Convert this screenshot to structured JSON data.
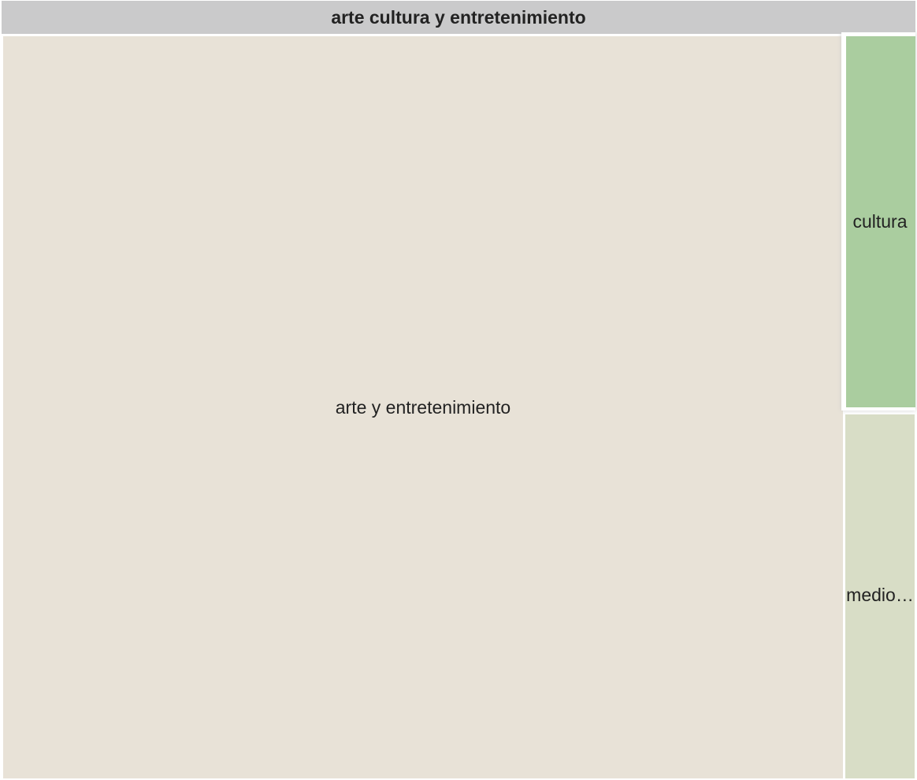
{
  "chart_data": {
    "type": "treemap",
    "title": "arte cultura y entretenimiento",
    "children": [
      {
        "name": "arte y entretenimiento",
        "label": "arte y entretenimiento",
        "color": "#e8e2d7",
        "highlighted": false
      },
      {
        "name": "cultura",
        "label": "cultura",
        "color": "#aacd9f",
        "highlighted": true
      },
      {
        "name": "medio…",
        "label": "medio…",
        "color": "#d8ddc6",
        "highlighted": false
      }
    ]
  },
  "colors": {
    "header": "#cacacb",
    "text": "#222222",
    "border": "#ffffff"
  }
}
